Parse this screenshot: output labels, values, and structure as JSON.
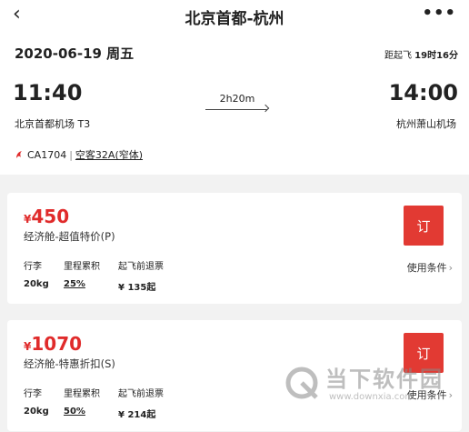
{
  "header": {
    "title": "北京首都-杭州",
    "back_icon": "chevron-left-icon",
    "more_icon": "more-horizontal-icon"
  },
  "flight": {
    "date": "2020-06-19 周五",
    "countdown_prefix": "距起飞",
    "countdown_value": "19时16分",
    "departure_time": "11:40",
    "arrival_time": "14:00",
    "duration": "2h20m",
    "departure_airport": "北京首都机场 T3",
    "arrival_airport": "杭州萧山机场",
    "flight_number": "CA1704",
    "separator": "|",
    "aircraft": "空客32A(窄体)",
    "airline_icon": "air-china-logo-icon",
    "accent_color": "#e02b2b"
  },
  "fares": [
    {
      "currency": "¥",
      "price": "450",
      "cabin": "经济舱-超值特价(P)",
      "baggage_label": "行李",
      "baggage_value": "20kg",
      "miles_label": "里程累积",
      "miles_value": "25%",
      "refund_label": "起飞前退票",
      "refund_value": "¥ 135起",
      "book_label": "订",
      "rules_label": "使用条件"
    },
    {
      "currency": "¥",
      "price": "1070",
      "cabin": "经济舱-特惠折扣(S)",
      "baggage_label": "行李",
      "baggage_value": "20kg",
      "miles_label": "里程累积",
      "miles_value": "50%",
      "refund_label": "起飞前退票",
      "refund_value": "¥ 214起",
      "book_label": "订",
      "rules_label": "使用条件"
    }
  ],
  "watermark": {
    "text": "当下软件园",
    "url": "www.downxia.com"
  },
  "colors": {
    "book_button": "#e23a33",
    "price": "#e02b2b"
  }
}
